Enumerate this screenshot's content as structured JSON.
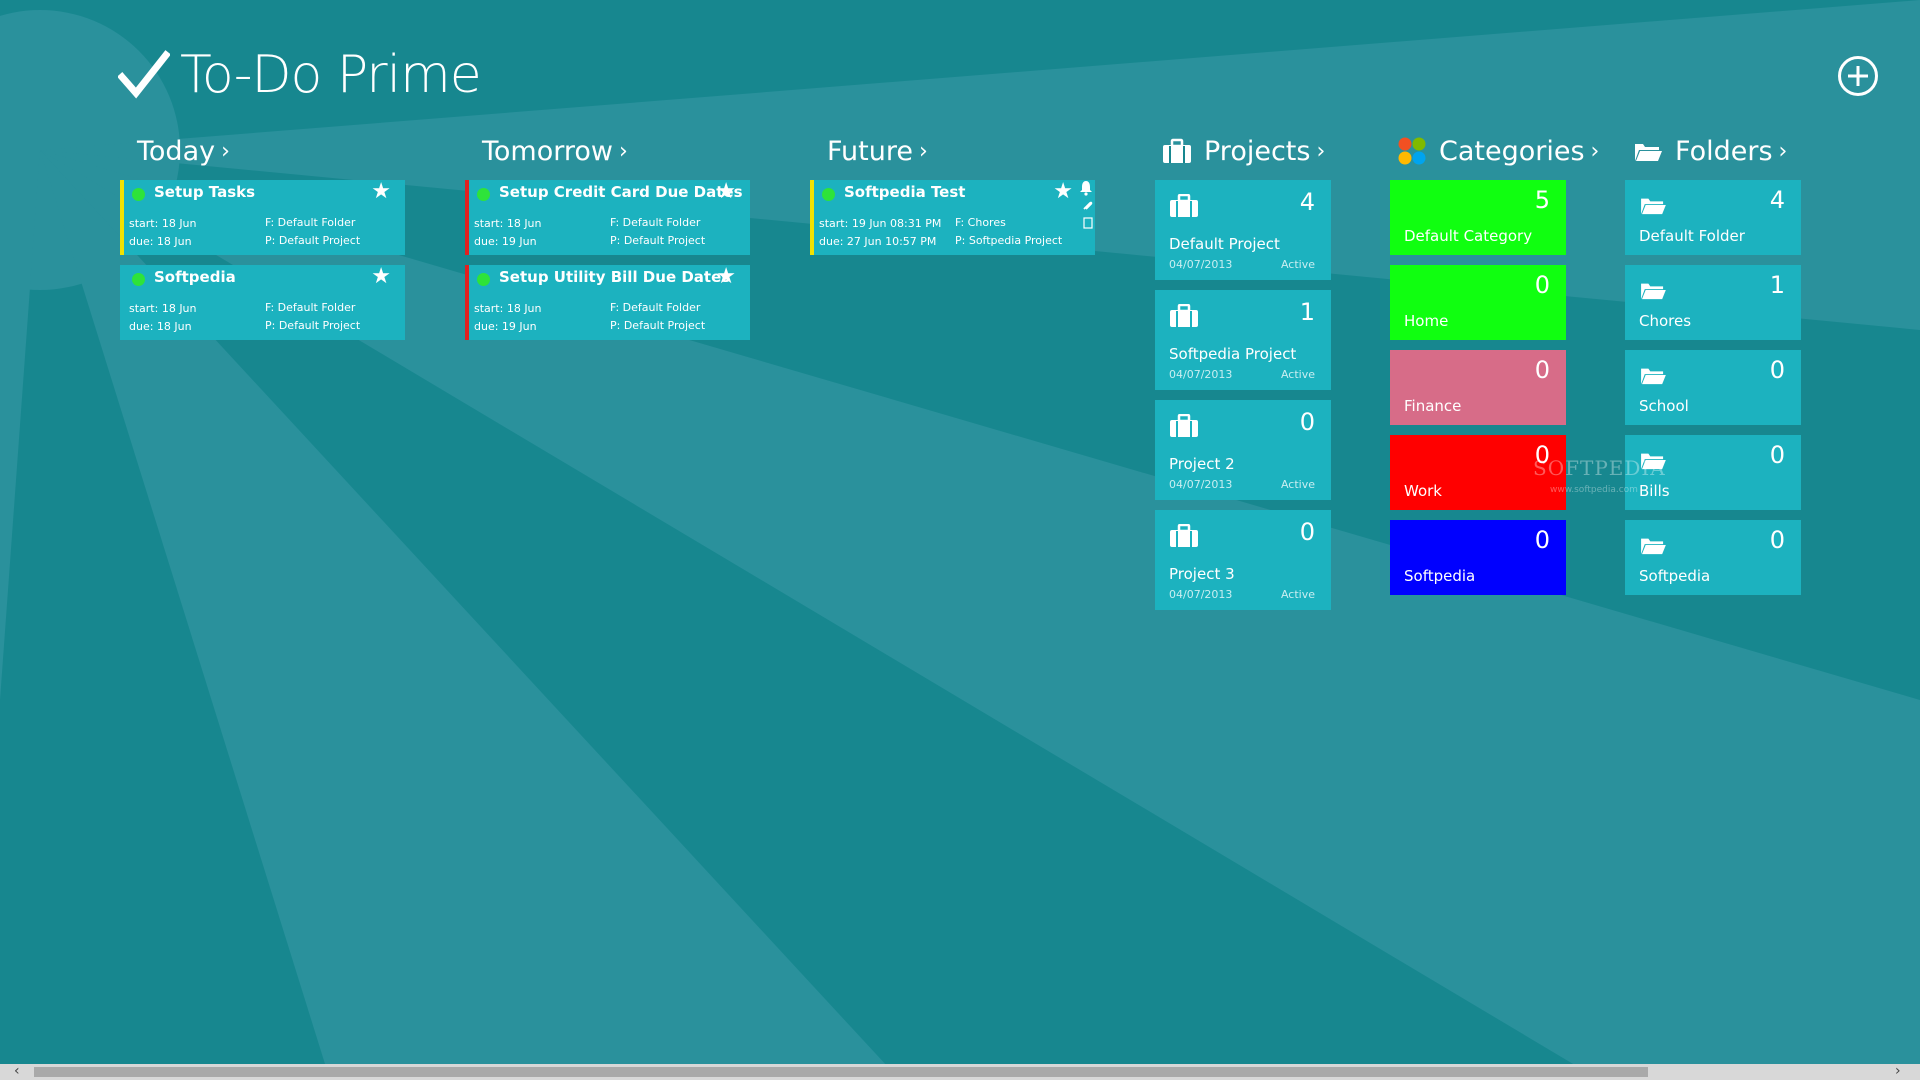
{
  "app": {
    "title": "To-Do Prime",
    "check_icon": "checkmark-icon",
    "add_icon": "plus-circle-icon"
  },
  "groups": {
    "today": {
      "label": "Today",
      "chev": "›"
    },
    "tomorrow": {
      "label": "Tomorrow",
      "chev": "›"
    },
    "future": {
      "label": "Future",
      "chev": "›"
    },
    "projects": {
      "label": "Projects",
      "chev": "›"
    },
    "categories": {
      "label": "Categories",
      "chev": "›"
    },
    "folders": {
      "label": "Folders",
      "chev": "›"
    }
  },
  "tasks": {
    "today": [
      {
        "title": "Setup Tasks",
        "start": "start: 18 Jun",
        "due": "due: 18 Jun",
        "folder": "F: Default Folder",
        "project": "P: Default Project",
        "star": "★",
        "edge_color": "#f2e200"
      },
      {
        "title": "Softpedia",
        "start": "start: 18 Jun",
        "due": "due: 18 Jun",
        "folder": "F: Default Folder",
        "project": "P: Default Project",
        "star": "★",
        "edge_color": "#1cb2bf"
      }
    ],
    "tomorrow": [
      {
        "title": "Setup Credit Card Due Dates",
        "start": "start: 18 Jun",
        "due": "due: 19 Jun",
        "folder": "F: Default Folder",
        "project": "P: Default Project",
        "star": "★",
        "edge_color": "#e02020"
      },
      {
        "title": "Setup Utility Bill Due Dates",
        "start": "start: 18 Jun",
        "due": "due: 19 Jun",
        "folder": "F: Default Folder",
        "project": "P: Default Project",
        "star": "★",
        "edge_color": "#e02020"
      }
    ],
    "future": [
      {
        "title": "Softpedia Test",
        "start": "start: 19 Jun  08:31 PM",
        "due": "due: 27 Jun  10:57 PM",
        "folder": "F: Chores",
        "project": "P: Softpedia Project",
        "star": "★",
        "edge_color": "#f2e200"
      }
    ]
  },
  "projects": [
    {
      "count": "4",
      "name": "Default Project",
      "date": "04/07/2013",
      "state": "Active"
    },
    {
      "count": "1",
      "name": "Softpedia Project",
      "date": "04/07/2013",
      "state": "Active"
    },
    {
      "count": "0",
      "name": "Project 2",
      "date": "04/07/2013",
      "state": "Active"
    },
    {
      "count": "0",
      "name": "Project 3",
      "date": "04/07/2013",
      "state": "Active"
    }
  ],
  "categories": [
    {
      "count": "5",
      "name": "Default Category",
      "color": "#10ff10"
    },
    {
      "count": "0",
      "name": "Home",
      "color": "#10ff10"
    },
    {
      "count": "0",
      "name": "Finance",
      "color": "#d76c88"
    },
    {
      "count": "0",
      "name": "Work",
      "color": "#ff0000"
    },
    {
      "count": "0",
      "name": "Softpedia",
      "color": "#0000ff"
    }
  ],
  "folders": [
    {
      "count": "4",
      "name": "Default Folder"
    },
    {
      "count": "1",
      "name": "Chores"
    },
    {
      "count": "0",
      "name": "School"
    },
    {
      "count": "0",
      "name": "Bills"
    },
    {
      "count": "0",
      "name": "Softpedia"
    }
  ],
  "watermark": {
    "text": "SOFTPEDIA",
    "url": "www.softpedia.com"
  },
  "colors": {
    "background": "#17878f",
    "tile": "#1cb2bf",
    "status_dot": "#2ee33a"
  }
}
